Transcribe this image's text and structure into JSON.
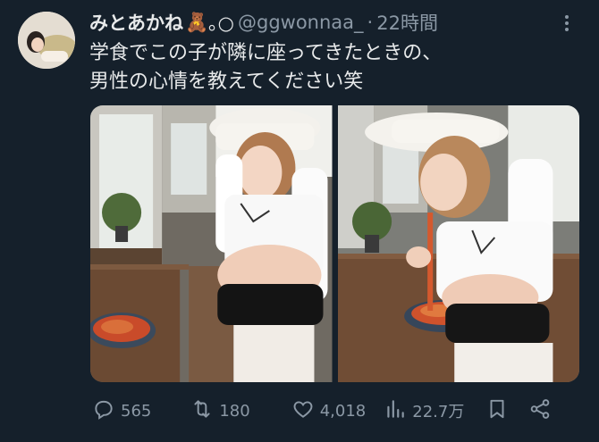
{
  "author": {
    "name": "みとあかね",
    "emoji": "🧸",
    "name_suffix": "｡○",
    "handle": "@ggwonnaa_",
    "separator": "·",
    "time": "22時間"
  },
  "tweet": {
    "line1": "学食でこの子が隣に座ってきたときの、",
    "line2": "男性の心情を教えてください笑"
  },
  "stats": {
    "replies": "565",
    "retweets": "180",
    "likes": "4,018",
    "views": "22.7万"
  },
  "colors": {
    "background": "#15202b",
    "text": "#e7e9ea",
    "muted": "#8b98a5"
  },
  "icons": [
    "more-icon",
    "reply-icon",
    "retweet-icon",
    "like-icon",
    "views-icon",
    "bookmark-icon",
    "share-icon"
  ]
}
